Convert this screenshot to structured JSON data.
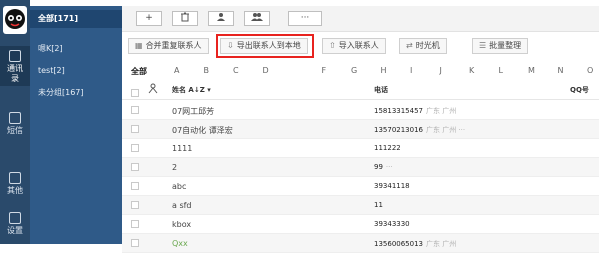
{
  "nav": {
    "items": [
      {
        "label_lines": [
          "通讯",
          "录"
        ],
        "icon": "address-book-icon",
        "active": true
      },
      {
        "label_lines": [
          "短信"
        ],
        "icon": "message-icon",
        "active": false
      },
      {
        "label_lines": [
          "其他"
        ],
        "icon": "grid-icon",
        "active": false
      },
      {
        "label_lines": [
          "设置"
        ],
        "icon": "gear-icon",
        "active": false
      }
    ]
  },
  "groups": [
    {
      "label": "全部[171]",
      "active": true
    },
    {
      "label": "嗯K[2]",
      "active": false
    },
    {
      "label": "test[2]",
      "active": false
    },
    {
      "label": "未分组[167]",
      "active": false
    }
  ],
  "toolbar1": {
    "add": "+",
    "delete": "🗑",
    "user": "♟",
    "group": "👥",
    "more": "···"
  },
  "toolbar2": {
    "merge": "合并重复联系人",
    "export": "导出联系人到本地",
    "import": "导入联系人",
    "timemachine": "时光机",
    "batch": "批量整理"
  },
  "alpha": {
    "all": "全部",
    "letters": [
      "A",
      "B",
      "C",
      "D",
      "",
      "F",
      "G",
      "H",
      "I",
      "J",
      "K",
      "L",
      "M",
      "N",
      "O"
    ]
  },
  "table": {
    "headers": {
      "name": "姓名 A↓Z ▾",
      "phone": "电话",
      "qq": "QQ号"
    },
    "rows": [
      {
        "name": "07网工邱芳",
        "phone": "15813315457",
        "loc": "广东 广州",
        "green": false
      },
      {
        "name": "07自动化 谭泽宏",
        "phone": "13570213016",
        "loc": "广东 广州 ···",
        "green": false
      },
      {
        "name": "1111",
        "phone": "111222",
        "loc": "",
        "green": false
      },
      {
        "name": "2",
        "phone": "99",
        "loc": "···",
        "green": false
      },
      {
        "name": "abc",
        "phone": "39341118",
        "loc": "",
        "green": false
      },
      {
        "name": "a sfd",
        "phone": "11",
        "loc": "",
        "green": false
      },
      {
        "name": "kbox",
        "phone": "39343330",
        "loc": "",
        "green": false
      },
      {
        "name": "Qxx",
        "phone": "13560065013",
        "loc": "广东 广州",
        "green": true
      }
    ]
  },
  "colors": {
    "nav_bg": "#2a4a6b",
    "group_bg": "#2f5a88",
    "highlight": "#e8231f"
  }
}
